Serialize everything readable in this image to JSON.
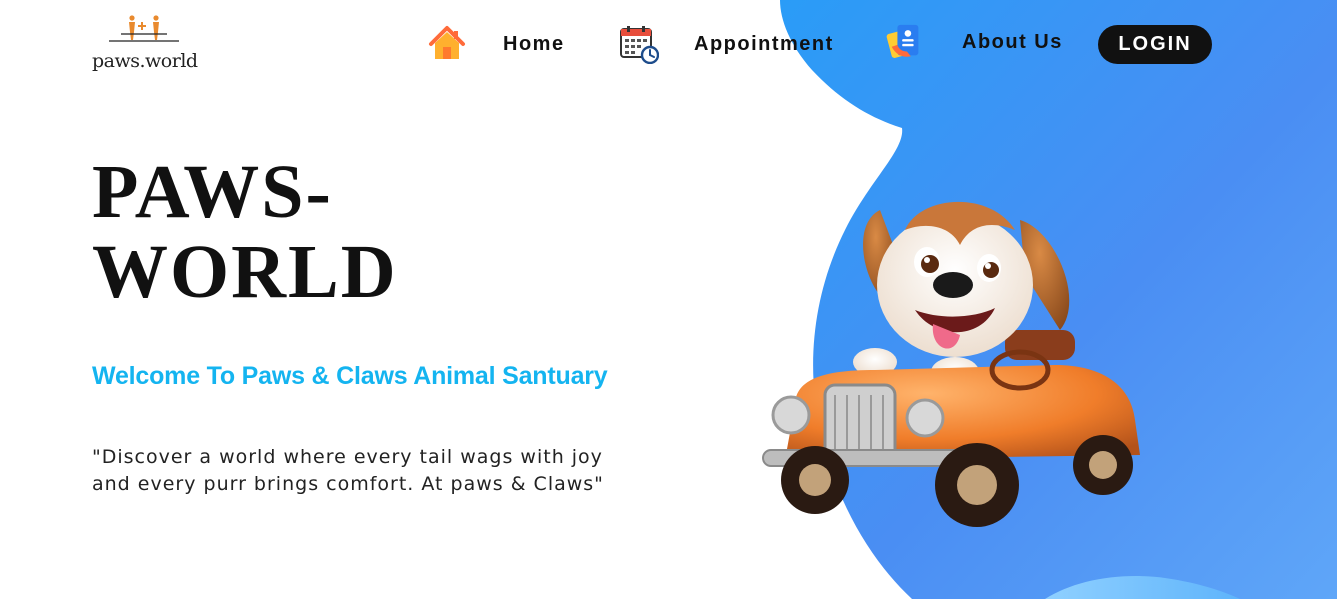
{
  "brand": {
    "logo_text": "paws.world"
  },
  "nav": {
    "home_label": "Home",
    "appointment_label": "Appointment",
    "about_label": "About Us",
    "login_label": "LOGIN"
  },
  "icons": {
    "home": "house-icon",
    "appointment": "calendar-clock-icon",
    "about": "contact-card-icon"
  },
  "hero": {
    "title": "PAWS-WORLD",
    "subtitle": "Welcome To Paws & Claws Animal Santuary",
    "quote": "\"Discover a world where every tail wags with joy and every purr brings comfort. At paws & Claws\""
  },
  "colors": {
    "accent": "#14b4f0",
    "blob_blue": "#3d8ff5",
    "login_bg": "#111111"
  }
}
